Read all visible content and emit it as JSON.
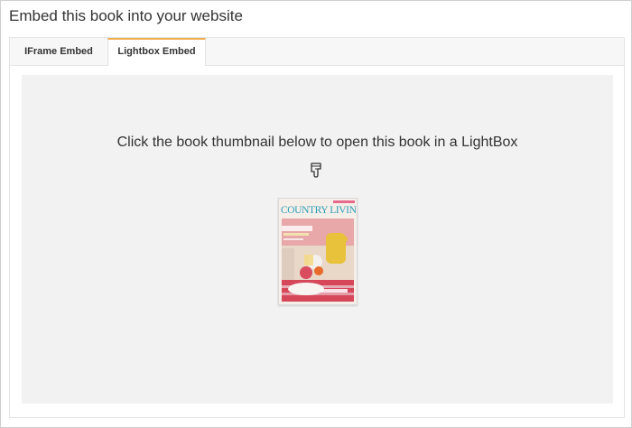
{
  "dialog": {
    "title": "Embed this book into your website"
  },
  "tabs": [
    {
      "label": "IFrame Embed",
      "active": false
    },
    {
      "label": "Lightbox Embed",
      "active": true
    }
  ],
  "lightbox": {
    "instruction": "Click the book thumbnail below to open this book in a LightBox",
    "pointer_icon": "hand-pointing-down-icon",
    "book": {
      "masthead": "COUNTRY LIVING"
    }
  },
  "colors": {
    "active_tab_accent": "#f0ad4e",
    "content_background": "#f2f2f2",
    "masthead": "#2a9fb7"
  }
}
